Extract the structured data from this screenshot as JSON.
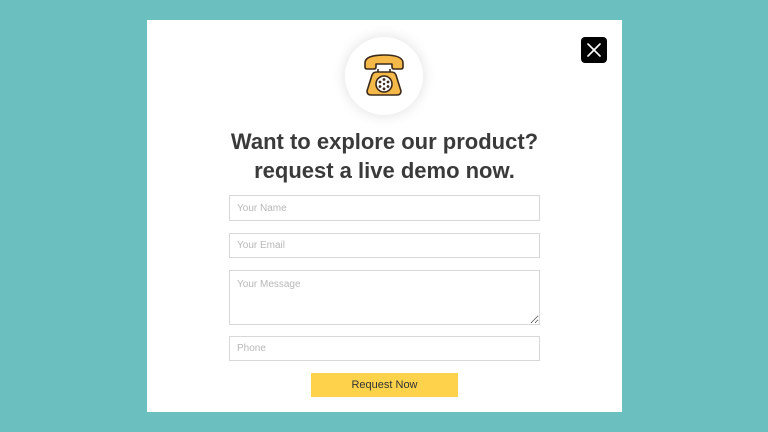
{
  "colors": {
    "background": "#6cbfbf",
    "modal": "#ffffff",
    "accent_button": "#fed24a",
    "close_button": "#000000",
    "headline": "#3a3a3a",
    "phone_icon": "#f5b94a"
  },
  "modal": {
    "icon": "telephone-icon",
    "close_icon": "close-icon",
    "headline_line1": "Want to explore our product?",
    "headline_line2": "request a live demo now."
  },
  "form": {
    "name_placeholder": "Your Name",
    "email_placeholder": "Your Email",
    "message_placeholder": "Your Message",
    "phone_placeholder": "Phone",
    "name_value": "",
    "email_value": "",
    "message_value": "",
    "phone_value": "",
    "submit_label": "Request Now"
  }
}
